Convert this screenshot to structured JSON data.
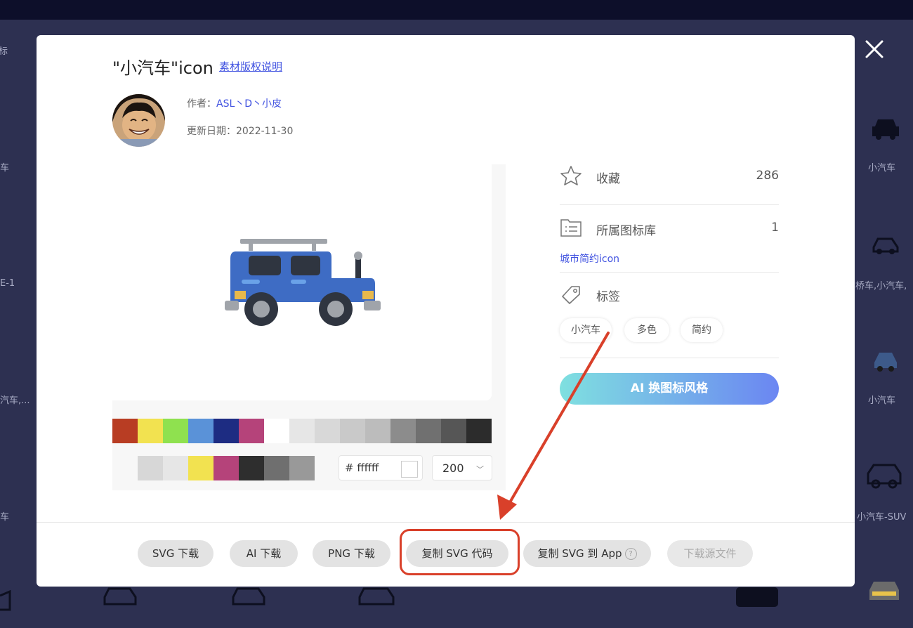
{
  "background": {
    "right_labels": [
      "小汽车",
      "桥车,小汽车,",
      "小汽车",
      "小汽车-SUV"
    ],
    "left_labels": [
      "标",
      "车",
      "E-1",
      "汽车,...",
      "车"
    ]
  },
  "modal": {
    "title": "\"小汽车\"icon",
    "copyright_link": "素材版权说明",
    "author_label": "作者：",
    "author_name": "ASL丶D丶小皮",
    "date_label": "更新日期：",
    "date_value": "2022-11-30",
    "palette_row1": [
      "#b83d23",
      "#f2e250",
      "#8fe14f",
      "#5a92d8",
      "#1d2c82",
      "#b5437a",
      "#ffffff",
      "#e6e6e6",
      "#d8d8d8",
      "#c9c9c9",
      "#bcbcbc",
      "#8c8c8c",
      "#707070",
      "#565656",
      "#2c2c2c"
    ],
    "palette_row2": [
      "#d7d7d7",
      "#e6e6e6",
      "#f2e250",
      "#b5437a",
      "#2e2e2e",
      "#6f6f6f",
      "#999999"
    ],
    "color_input": {
      "hash": "#",
      "value": "ffffff"
    },
    "size_select": {
      "value": "200",
      "chevron": "﹀"
    },
    "side": {
      "favorite_label": "收藏",
      "favorite_count": "286",
      "library_label": "所属图标库",
      "library_count": "1",
      "library_link": "城市简约icon",
      "tags_label": "标签",
      "tags": [
        "小汽车",
        "多色",
        "简约"
      ],
      "ai_button": "AI 换图标风格"
    },
    "footer_buttons": {
      "svg_download": "SVG 下载",
      "ai_download": "AI 下载",
      "png_download": "PNG 下载",
      "copy_svg_code": "复制 SVG 代码",
      "copy_svg_to_app": "复制 SVG 到 App",
      "help_mark": "?",
      "download_source": "下载源文件"
    }
  },
  "annotation_color": "#d9402a"
}
